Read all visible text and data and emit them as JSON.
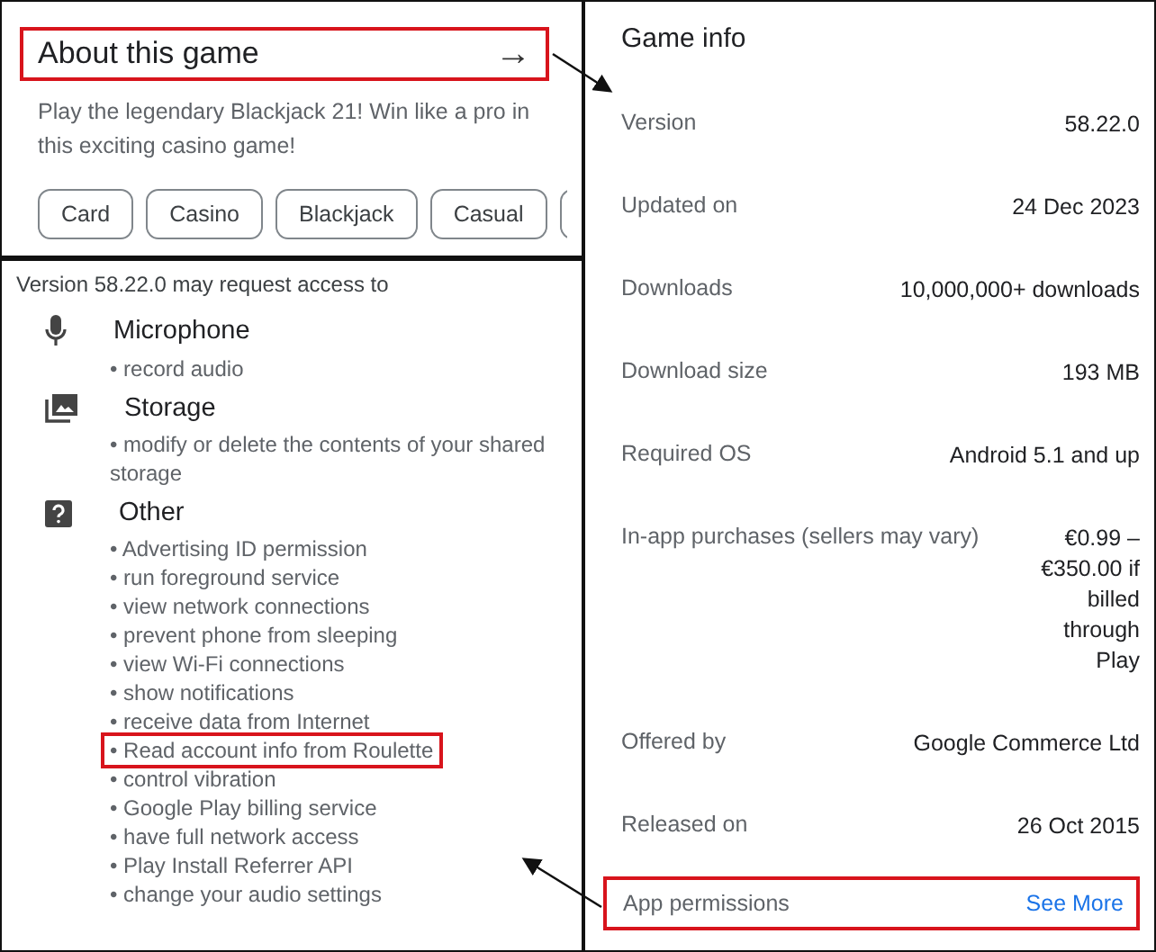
{
  "about": {
    "title": "About this game",
    "highlighted": true,
    "arrow": "→",
    "description": "Play the legendary Blackjack 21! Win like a pro in this exciting casino game!",
    "tags": [
      "Card",
      "Casino",
      "Blackjack",
      "Casual"
    ]
  },
  "permissions": {
    "intro": "Version 58.22.0 may request access to",
    "groups": [
      {
        "kind": "microphone",
        "name": "Microphone",
        "items": [
          {
            "text": "• record audio",
            "highlighted": false
          }
        ]
      },
      {
        "kind": "storage",
        "name": "Storage",
        "items": [
          {
            "text": "• modify or delete the contents of your shared storage",
            "highlighted": false
          }
        ]
      },
      {
        "kind": "other",
        "name": "Other",
        "items": [
          {
            "text": "• Advertising ID permission",
            "highlighted": false
          },
          {
            "text": "• run foreground service",
            "highlighted": false
          },
          {
            "text": "• view network connections",
            "highlighted": false
          },
          {
            "text": "• prevent phone from sleeping",
            "highlighted": false
          },
          {
            "text": "• view Wi-Fi connections",
            "highlighted": false
          },
          {
            "text": "• show notifications",
            "highlighted": false
          },
          {
            "text": "• receive data from Internet",
            "highlighted": false
          },
          {
            "text": "• Read account info from Roulette",
            "highlighted": true
          },
          {
            "text": "• control vibration",
            "highlighted": false
          },
          {
            "text": "• Google Play billing service",
            "highlighted": false
          },
          {
            "text": "• have full network access",
            "highlighted": false
          },
          {
            "text": "• Play Install Referrer API",
            "highlighted": false
          },
          {
            "text": "• change your audio settings",
            "highlighted": false
          }
        ]
      }
    ]
  },
  "game_info": {
    "title": "Game info",
    "rows": [
      {
        "label": "Version",
        "value": "58.22.0"
      },
      {
        "label": "Updated on",
        "value": "24 Dec 2023"
      },
      {
        "label": "Downloads",
        "value": "10,000,000+ downloads"
      },
      {
        "label": "Download size",
        "value": "193 MB"
      },
      {
        "label": "Required OS",
        "value": "Android 5.1 and up"
      },
      {
        "label": "In-app purchases (sellers may vary)",
        "value": "€0.99 – €350.00 if billed through Play"
      },
      {
        "label": "Offered by",
        "value": "Google Commerce Ltd"
      },
      {
        "label": "Released on",
        "value": "26 Oct 2015"
      }
    ],
    "footer": {
      "label": "App permissions",
      "link": "See More",
      "highlighted": true
    }
  }
}
